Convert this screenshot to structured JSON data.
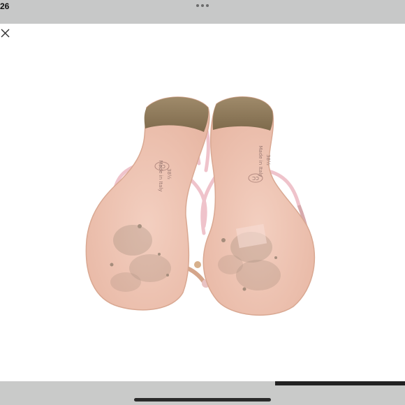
{
  "status_bar": {
    "time": "26"
  },
  "viewer": {
    "progress_fraction": 0.32
  },
  "product": {
    "sole_left_text": "38½",
    "sole_right_text": "38½",
    "brand_mark": "CC",
    "origin_text": "Made in Italy"
  },
  "colors": {
    "status_bar": "#c7c8c8",
    "sole": "#efc4b4",
    "heel": "#9d8868",
    "strap": "#efc3cb"
  },
  "icons": {
    "close": "close-icon",
    "more": "more-dots-icon"
  }
}
